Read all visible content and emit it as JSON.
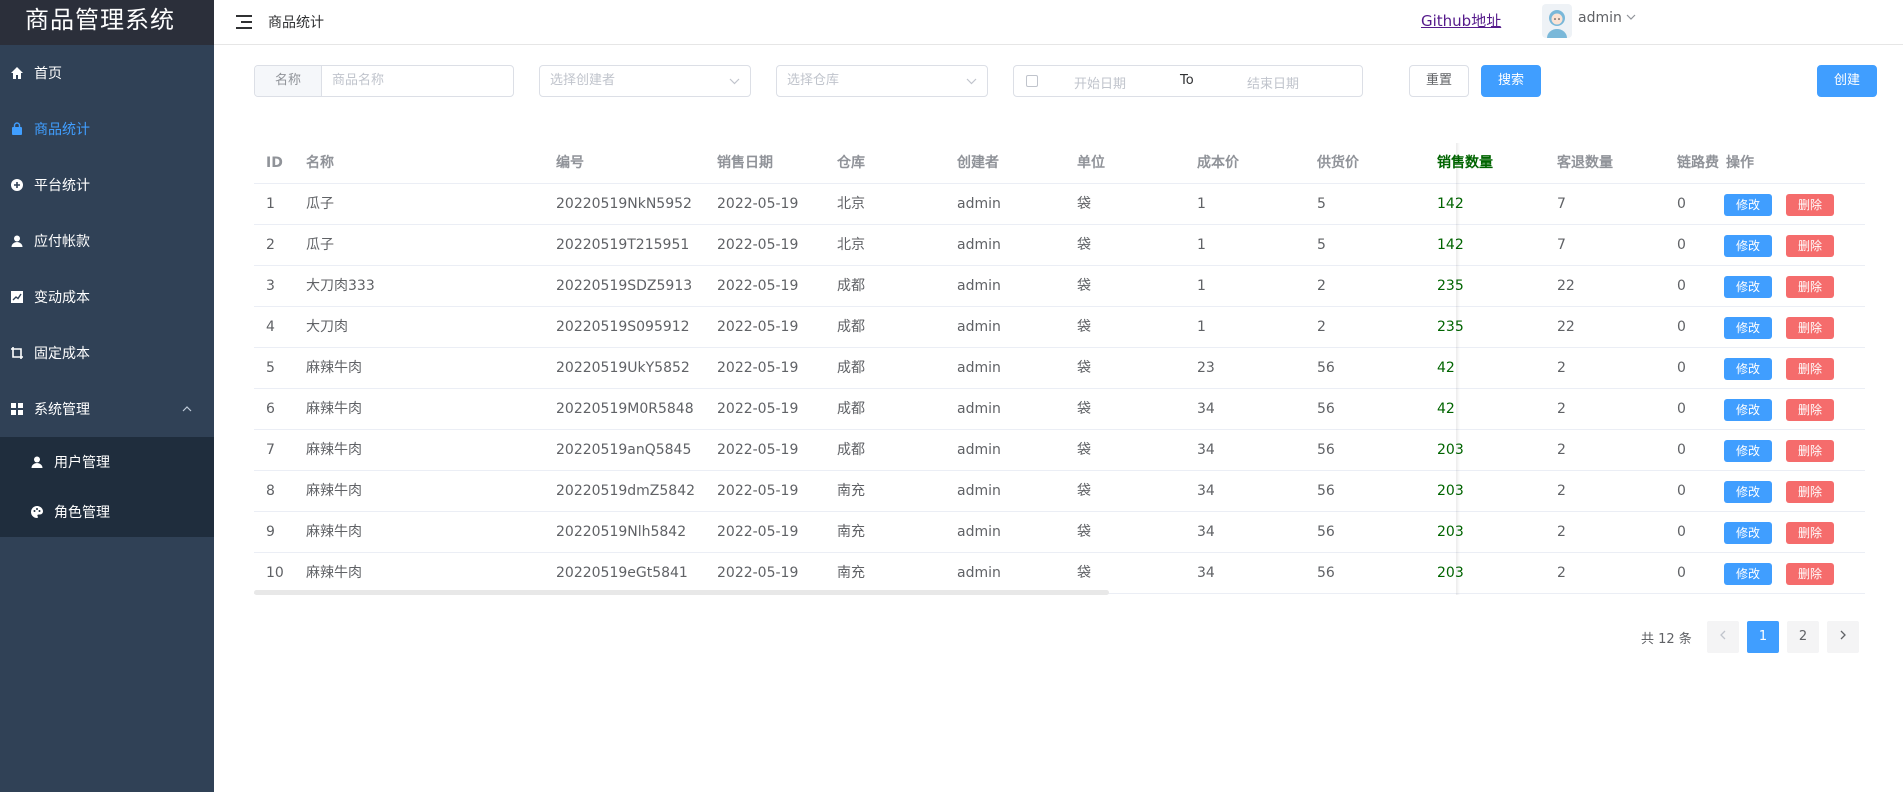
{
  "app": {
    "title": "商品管理系统"
  },
  "sidebar": {
    "items": [
      {
        "label": "首页",
        "icon": "home-icon"
      },
      {
        "label": "商品统计",
        "icon": "shopping-bag-icon",
        "active": true
      },
      {
        "label": "平台统计",
        "icon": "plus-circle-icon"
      },
      {
        "label": "应付帐款",
        "icon": "user-icon"
      },
      {
        "label": "变动成本",
        "icon": "line-chart-icon"
      },
      {
        "label": "固定成本",
        "icon": "crop-icon"
      },
      {
        "label": "系统管理",
        "icon": "grid-icon",
        "expanded": true
      }
    ],
    "submenu": [
      {
        "label": "用户管理",
        "icon": "user-icon"
      },
      {
        "label": "角色管理",
        "icon": "palette-icon"
      }
    ]
  },
  "header": {
    "breadcrumb": "商品统计",
    "github_link": "Github地址",
    "username": "admin"
  },
  "filters": {
    "name_label": "名称",
    "name_placeholder": "商品名称",
    "creator_placeholder": "选择创建者",
    "warehouse_placeholder": "选择仓库",
    "start_date_placeholder": "开始日期",
    "range_separator": "To",
    "end_date_placeholder": "结束日期",
    "reset_label": "重置",
    "search_label": "搜索",
    "create_label": "创建"
  },
  "table": {
    "columns": [
      "ID",
      "名称",
      "编号",
      "销售日期",
      "仓库",
      "创建者",
      "单位",
      "成本价",
      "供货价",
      "销售数量",
      "客退数量",
      "链路费",
      "操作"
    ],
    "edit_label": "修改",
    "delete_label": "删除",
    "rows": [
      [
        "1",
        "瓜子",
        "20220519NkN5952",
        "2022-05-19",
        "北京",
        "admin",
        "袋",
        "1",
        "5",
        "142",
        "7",
        "0"
      ],
      [
        "2",
        "瓜子",
        "20220519T215951",
        "2022-05-19",
        "北京",
        "admin",
        "袋",
        "1",
        "5",
        "142",
        "7",
        "0"
      ],
      [
        "3",
        "大刀肉333",
        "20220519SDZ5913",
        "2022-05-19",
        "成都",
        "admin",
        "袋",
        "1",
        "2",
        "235",
        "22",
        "0"
      ],
      [
        "4",
        "大刀肉",
        "20220519S095912",
        "2022-05-19",
        "成都",
        "admin",
        "袋",
        "1",
        "2",
        "235",
        "22",
        "0"
      ],
      [
        "5",
        "麻辣牛肉",
        "20220519UkY5852",
        "2022-05-19",
        "成都",
        "admin",
        "袋",
        "23",
        "56",
        "42",
        "2",
        "0"
      ],
      [
        "6",
        "麻辣牛肉",
        "20220519M0R5848",
        "2022-05-19",
        "成都",
        "admin",
        "袋",
        "34",
        "56",
        "42",
        "2",
        "0"
      ],
      [
        "7",
        "麻辣牛肉",
        "20220519anQ5845",
        "2022-05-19",
        "成都",
        "admin",
        "袋",
        "34",
        "56",
        "203",
        "2",
        "0"
      ],
      [
        "8",
        "麻辣牛肉",
        "20220519dmZ5842",
        "2022-05-19",
        "南充",
        "admin",
        "袋",
        "34",
        "56",
        "203",
        "2",
        "0"
      ],
      [
        "9",
        "麻辣牛肉",
        "20220519Nlh5842",
        "2022-05-19",
        "南充",
        "admin",
        "袋",
        "34",
        "56",
        "203",
        "2",
        "0"
      ],
      [
        "10",
        "麻辣牛肉",
        "20220519eGt5841",
        "2022-05-19",
        "南充",
        "admin",
        "袋",
        "34",
        "56",
        "203",
        "2",
        "0"
      ]
    ]
  },
  "pagination": {
    "total_text": "共 12 条",
    "pages": [
      "1",
      "2"
    ],
    "current": "1"
  },
  "colors": {
    "sidebar_bg": "#304156",
    "primary": "#409eff",
    "danger": "#f56c6c",
    "sold_qty": "#006400"
  }
}
